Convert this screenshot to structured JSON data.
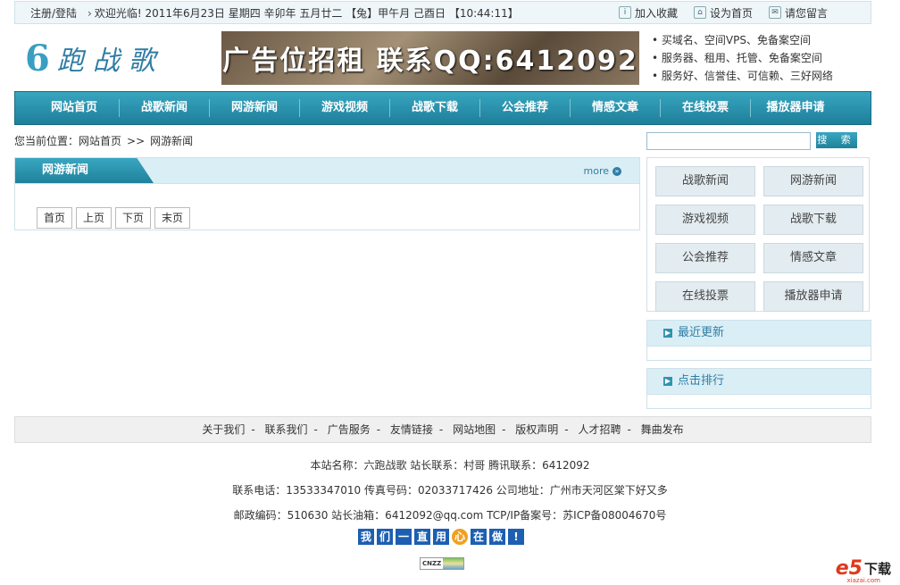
{
  "topbar": {
    "login": "注册/登陆",
    "welcome": "欢迎光临! 2011年6月23日  星期四   辛卯年 五月廿二 【兔】甲午月 己酉日 【10:44:11】",
    "favorite": "加入收藏",
    "homepage": "设为首页",
    "message": "请您留言"
  },
  "header": {
    "logo_num": "6",
    "logo_text": "跑战歌",
    "banner": "广告位招租 联系QQ:6412092",
    "list": [
      "买域名、空间VPS、免备案空间",
      "服务器、租用、托管、免备案空间",
      "服务好、信誉佳、可信赖、三好网络"
    ]
  },
  "nav": [
    "网站首页",
    "战歌新闻",
    "网游新闻",
    "游戏视频",
    "战歌下载",
    "公会推荐",
    "情感文章",
    "在线投票",
    "播放器申请"
  ],
  "breadcrumb": {
    "prefix": "您当前位置：",
    "home": "网站首页",
    "sep": ">>",
    "current": "网游新闻"
  },
  "main": {
    "tab": "网游新闻",
    "more": "more",
    "pager": [
      "首页",
      "上页",
      "下页",
      "末页"
    ]
  },
  "sidebar": {
    "search_button": "搜 索",
    "search_placeholder": "",
    "grid": [
      "战歌新闻",
      "网游新闻",
      "游戏视频",
      "战歌下载",
      "公会推荐",
      "情感文章",
      "在线投票",
      "播放器申请"
    ],
    "recent": "最近更新",
    "rank": "点击排行"
  },
  "footer": {
    "links": [
      "关于我们",
      "联系我们",
      "广告服务",
      "友情链接",
      "网站地图",
      "版权声明",
      "人才招聘",
      "舞曲发布"
    ],
    "line1": "本站名称：六跑战歌 站长联系：村哥 腾讯联系：6412092",
    "line2": "联系电话：13533347010 传真号码：02033717426 公司地址：广州市天河区棠下好又多",
    "line3": "邮政编码：510630 站长油箱：6412092@qq.com TCP/IP备案号：苏ICP备08004670号",
    "badge": [
      "我",
      "们",
      "一",
      "直",
      "用",
      "心",
      "在",
      "做",
      "!"
    ],
    "cnzz": "CNZZ"
  },
  "watermark": {
    "e": "e5",
    "download": "下载",
    "sub": "xiazai.com"
  }
}
